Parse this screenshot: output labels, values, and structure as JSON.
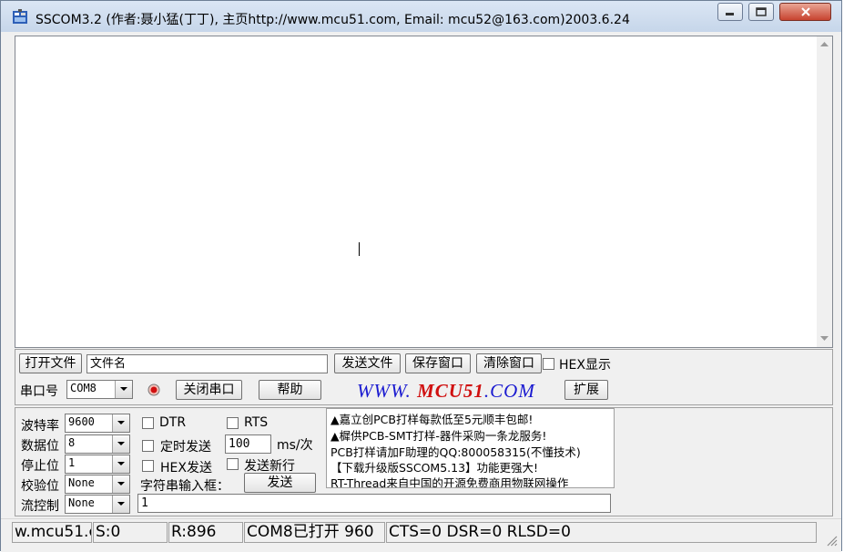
{
  "window": {
    "title": "SSCOM3.2 (作者:聂小猛(丁丁), 主页http://www.mcu51.com,  Email: mcu52@163.com)2003.6.24"
  },
  "toolbar1": {
    "open_file": "打开文件",
    "filename_value": "文件名",
    "send_file": "发送文件",
    "save_window": "保存窗口",
    "clear_window": "清除窗口",
    "hex_display": "HEX显示"
  },
  "toolbar2": {
    "port_label": "串口号",
    "port_value": "COM8",
    "close_port": "关闭串口",
    "help": "帮助",
    "logo_prefix": "WWW.",
    "logo_brand": "MCU51",
    "logo_suffix": ".COM",
    "expand": "扩展"
  },
  "settings": {
    "baud_label": "波特率",
    "baud_value": "9600",
    "databits_label": "数据位",
    "databits_value": "8",
    "stopbits_label": "停止位",
    "stopbits_value": "1",
    "parity_label": "校验位",
    "parity_value": "None",
    "flow_label": "流控制",
    "flow_value": "None"
  },
  "options": {
    "dtr": "DTR",
    "rts": "RTS",
    "timed_send": "定时发送",
    "interval_value": "100",
    "interval_unit": "ms/次",
    "hex_send": "HEX发送",
    "send_newline": "发送新行",
    "input_label": "字符串输入框：",
    "send": "发送",
    "input_value": "1"
  },
  "ads": [
    "▲嘉立创PCB打样每款低至5元顺丰包邮!",
    "▲樨供PCB-SMT打样-器件采购一条龙服务!",
    "PCB打样请加F助理的QQ:800058315(不懂技术)",
    "【下载升级版SSCOM5.13】功能更强大!",
    "RT-Thread来自中国的开源免费商用物联网操作"
  ],
  "status": {
    "site": "w.mcu51.c",
    "sent": "S:0",
    "received": "R:896",
    "port_state": "COM8已打开  960",
    "lines": "CTS=0 DSR=0 RLSD=0"
  },
  "colors": {
    "logo_blue": "#1a1ad0",
    "logo_red": "#d01010",
    "title_bar": "#c6d6ea"
  }
}
